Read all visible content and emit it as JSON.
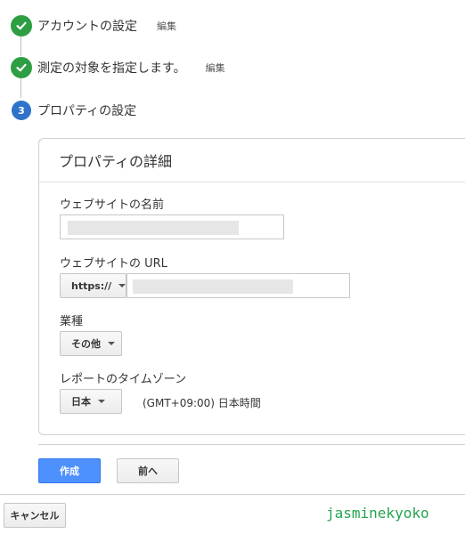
{
  "steps": [
    {
      "label": "アカウントの設定",
      "edit": "編集",
      "status": "done"
    },
    {
      "label": "測定の対象を指定します。",
      "edit": "編集",
      "status": "done"
    },
    {
      "label": "プロパティの設定",
      "number": "3",
      "status": "active"
    }
  ],
  "card": {
    "title": "プロパティの詳細",
    "website_name_label": "ウェブサイトの名前",
    "website_url_label": "ウェブサイトの URL",
    "protocol": "https://",
    "industry_label": "業種",
    "industry_value": "その他",
    "timezone_label": "レポートのタイムゾーン",
    "timezone_country": "日本",
    "timezone_value": "(GMT+09:00) 日本時間"
  },
  "buttons": {
    "create": "作成",
    "back": "前へ",
    "cancel": "キャンセル"
  },
  "watermark": "jasminekyoko",
  "colors": {
    "check_green": "#2e9e43",
    "step_blue": "#2f72c9",
    "primary_button": "#4d90fe",
    "watermark_green": "#23a44f"
  }
}
